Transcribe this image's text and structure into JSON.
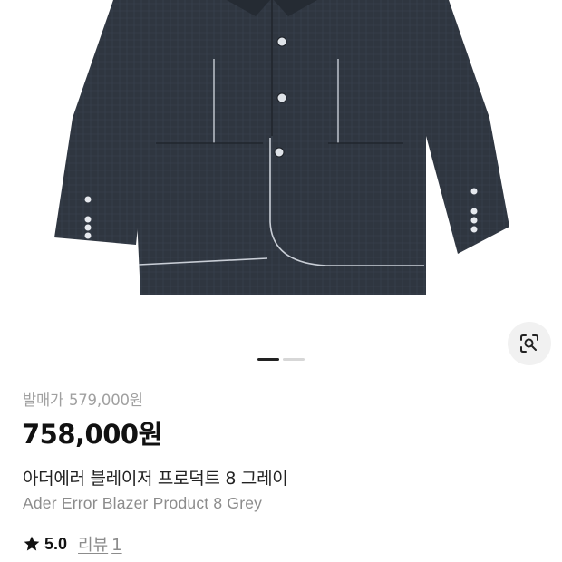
{
  "product": {
    "image_alt": "dark navy check blazer with white contrast stitching",
    "carousel": {
      "total": 2,
      "active": 1
    },
    "icons": {
      "lens": "lens-search-icon",
      "star": "star-icon"
    },
    "release_price_label": "발매가",
    "release_price": "579,000원",
    "current_price": "758,000원",
    "name_ko": "아더에러 블레이저 프로덕트 8 그레이",
    "name_en": "Ader Error Blazer Product 8 Grey",
    "rating": "5.0",
    "review_label": "리뷰",
    "review_count": "1"
  },
  "colors": {
    "price_text": "#111111",
    "muted_text": "#8c8c8c",
    "indicator_active": "#222222",
    "indicator_inactive": "#d7d7d7",
    "jacket_fabric": "#2f3640"
  }
}
